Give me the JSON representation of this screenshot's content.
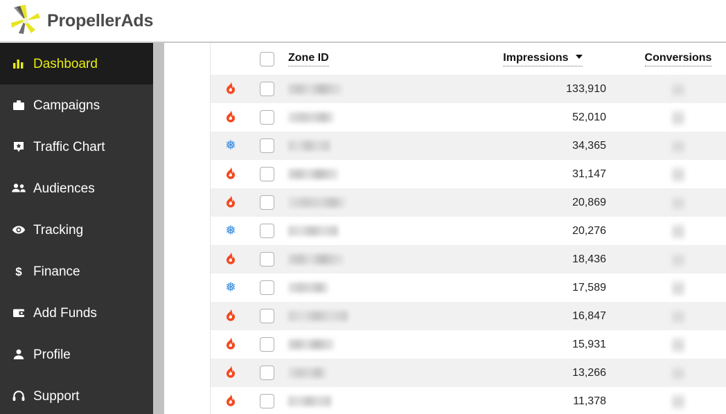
{
  "brand": {
    "name": "PropellerAds",
    "logo_icon": "propeller-logo-icon",
    "logo_yellow": "#e8e523",
    "logo_gray": "#6f6f6f"
  },
  "sidebar": {
    "bg_color": "#333333",
    "active_bg_color": "#1c1c1c",
    "active_text_color": "#e9ec13",
    "items": [
      {
        "label": "Dashboard",
        "icon": "bar-chart-icon",
        "active": true
      },
      {
        "label": "Campaigns",
        "icon": "briefcase-icon",
        "active": false
      },
      {
        "label": "Traffic Chart",
        "icon": "tag-star-icon",
        "active": false
      },
      {
        "label": "Audiences",
        "icon": "people-icon",
        "active": false
      },
      {
        "label": "Tracking",
        "icon": "eye-icon",
        "active": false
      },
      {
        "label": "Finance",
        "icon": "dollar-icon",
        "active": false
      },
      {
        "label": "Add Funds",
        "icon": "wallet-icon",
        "active": false
      },
      {
        "label": "Profile",
        "icon": "person-icon",
        "active": false
      },
      {
        "label": "Support",
        "icon": "headset-icon",
        "active": false
      }
    ]
  },
  "table": {
    "columns": {
      "flag": "",
      "select_all": "select-all-checkbox",
      "zone_id": "Zone ID",
      "impressions": "Impressions",
      "conversions": "Conversions"
    },
    "sort": {
      "column": "Impressions",
      "direction": "desc",
      "caret_icon": "caret-down-icon"
    },
    "flame_color": "#f5481f",
    "snow_color": "#3d8fdd",
    "rows": [
      {
        "flag": "flame",
        "checked": false,
        "zone_id": "",
        "zone_redacted": true,
        "impressions": "133,910",
        "conversions": "",
        "conversions_redacted": true
      },
      {
        "flag": "flame",
        "checked": false,
        "zone_id": "",
        "zone_redacted": true,
        "impressions": "52,010",
        "conversions": "",
        "conversions_redacted": true
      },
      {
        "flag": "snow",
        "checked": false,
        "zone_id": "",
        "zone_redacted": true,
        "impressions": "34,365",
        "conversions": "",
        "conversions_redacted": true
      },
      {
        "flag": "flame",
        "checked": false,
        "zone_id": "",
        "zone_redacted": true,
        "impressions": "31,147",
        "conversions": "",
        "conversions_redacted": true
      },
      {
        "flag": "flame",
        "checked": false,
        "zone_id": "",
        "zone_redacted": true,
        "impressions": "20,869",
        "conversions": "",
        "conversions_redacted": true
      },
      {
        "flag": "snow",
        "checked": false,
        "zone_id": "",
        "zone_redacted": true,
        "impressions": "20,276",
        "conversions": "",
        "conversions_redacted": true
      },
      {
        "flag": "flame",
        "checked": false,
        "zone_id": "",
        "zone_redacted": true,
        "impressions": "18,436",
        "conversions": "",
        "conversions_redacted": true
      },
      {
        "flag": "snow",
        "checked": false,
        "zone_id": "",
        "zone_redacted": true,
        "impressions": "17,589",
        "conversions": "",
        "conversions_redacted": true
      },
      {
        "flag": "flame",
        "checked": false,
        "zone_id": "",
        "zone_redacted": true,
        "impressions": "16,847",
        "conversions": "",
        "conversions_redacted": true
      },
      {
        "flag": "flame",
        "checked": false,
        "zone_id": "",
        "zone_redacted": true,
        "impressions": "15,931",
        "conversions": "",
        "conversions_redacted": true
      },
      {
        "flag": "flame",
        "checked": false,
        "zone_id": "",
        "zone_redacted": true,
        "impressions": "13,266",
        "conversions": "",
        "conversions_redacted": true
      },
      {
        "flag": "flame",
        "checked": false,
        "zone_id": "",
        "zone_redacted": true,
        "impressions": "11,378",
        "conversions": "",
        "conversions_redacted": true
      }
    ]
  }
}
